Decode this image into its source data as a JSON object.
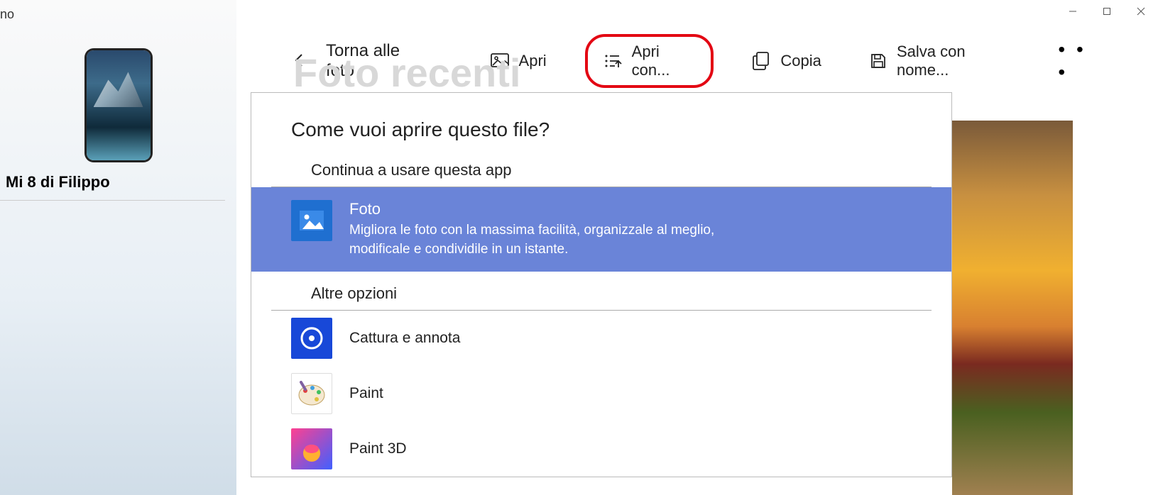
{
  "sidebar": {
    "top_label": "no",
    "device_name": "Mi 8 di Filippo"
  },
  "window": {
    "minimize_icon": "minimize-icon",
    "maximize_icon": "maximize-icon",
    "close_icon": "close-icon"
  },
  "toolbar": {
    "back_label": "Torna alle foto",
    "open_label": "Apri",
    "open_with_label": "Apri con...",
    "copy_label": "Copia",
    "save_as_label": "Salva con nome...",
    "more_label": "• • •"
  },
  "background_title": "Foto recenti",
  "dialog": {
    "title": "Come vuoi aprire questo file?",
    "continue_label": "Continua a usare questa app",
    "selected_app": {
      "name": "Foto",
      "description": "Migliora le foto con la massima facilità, organizzale al meglio, modificale e condividile in un istante."
    },
    "other_label": "Altre opzioni",
    "other_apps": [
      {
        "name": "Cattura e annota",
        "icon": "snip"
      },
      {
        "name": "Paint",
        "icon": "paint"
      },
      {
        "name": "Paint 3D",
        "icon": "paint3d"
      }
    ]
  }
}
